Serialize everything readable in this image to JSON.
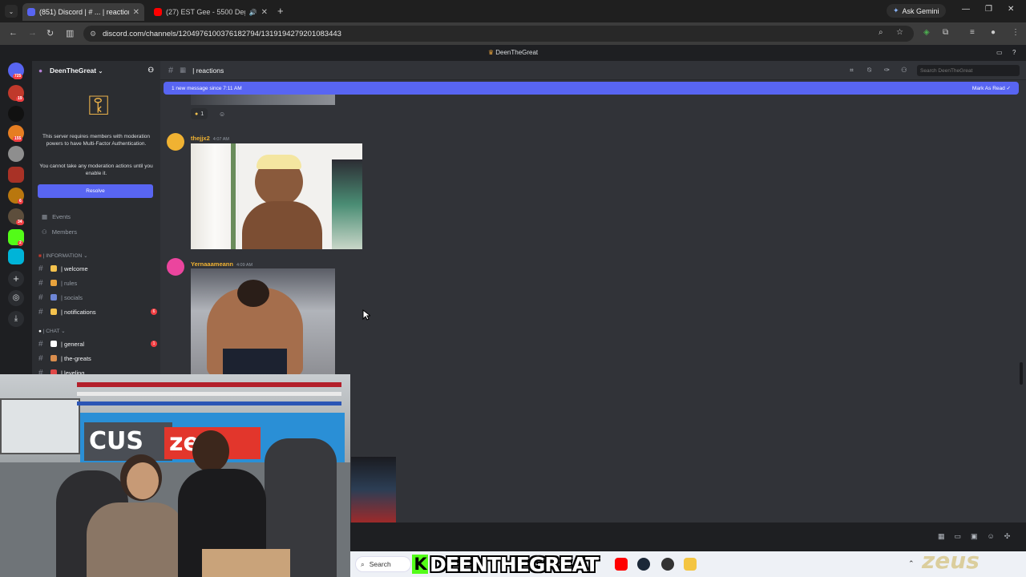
{
  "browser": {
    "tabs": [
      {
        "title": "(851) Discord | # ... | reactions",
        "active": true,
        "favicon_color": "#5865f2"
      },
      {
        "title": "(27) EST Gee - 5500 Degrees",
        "active": false,
        "favicon_color": "#ff0000"
      }
    ],
    "gemini_label": "Ask Gemini",
    "url": "discord.com/channels/1204976100376182794/1319194279201083443"
  },
  "discord": {
    "window_title": "DeenTheGreat",
    "server_name": "DeenTheGreat",
    "rail_badges": [
      "725",
      "19",
      "155",
      "6",
      "34",
      "2"
    ],
    "mfa_notice": "This server requires members with moderation powers to have Multi-Factor Authentication.",
    "mfa_sub": "You cannot take any moderation actions until you enable it.",
    "resolve_label": "Resolve",
    "links": [
      {
        "icon": "calendar-icon",
        "label": "Events"
      },
      {
        "icon": "members-icon",
        "label": "Members"
      }
    ],
    "categories": {
      "information": "| INFORMATION",
      "chat": "| CHAT"
    },
    "channels_info": [
      {
        "name": "| welcome",
        "unread": true,
        "emoji_color": "#f4c24d",
        "badge": ""
      },
      {
        "name": "| rules",
        "unread": false,
        "emoji_color": "#e8a33d",
        "badge": ""
      },
      {
        "name": "| socials",
        "unread": false,
        "emoji_color": "#6e86d6",
        "badge": ""
      },
      {
        "name": "| notifications",
        "unread": true,
        "emoji_color": "#f4c24d",
        "badge": "6"
      }
    ],
    "channels_chat": [
      {
        "name": "| general",
        "unread": true,
        "emoji_color": "#ffffff",
        "badge": "1"
      },
      {
        "name": "| the-greats",
        "unread": true,
        "emoji_color": "#d98d4d",
        "badge": ""
      },
      {
        "name": "| leveling",
        "unread": true,
        "emoji_color": "#e04848",
        "badge": ""
      }
    ],
    "channel_header": "| reactions",
    "search_placeholder": "Search DeenTheGreat",
    "new_message_bar": "1 new message since 7:11 AM",
    "mark_as_read": "Mark As Read",
    "reaction_count": "1",
    "messages": [
      {
        "user": "thejjx2",
        "time": "4:07 AM",
        "name_color": "#f0b232",
        "avatar_color": "#f0b232"
      },
      {
        "user": "Yernaaameann",
        "time": "4:09 AM",
        "name_color": "#f0b232",
        "avatar_color": "#eb459e"
      }
    ]
  },
  "taskbar": {
    "search_label": "Search",
    "banner_text": "DEENTHEGREAT",
    "banner_k": "K",
    "watermark": "zeus"
  }
}
